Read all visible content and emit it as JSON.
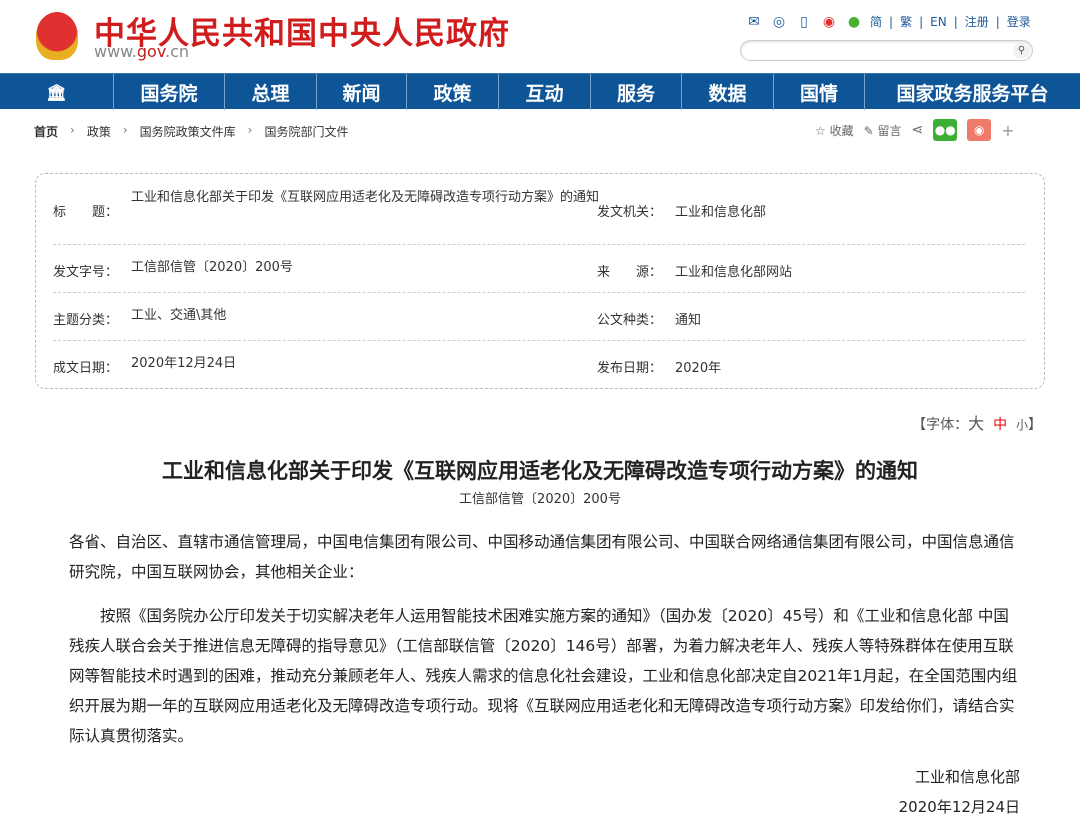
{
  "header": {
    "site_title": "中华人民共和国中央人民政府",
    "url_prefix": "www.",
    "url_mid": "gov",
    "url_suffix": ".cn",
    "links": [
      "简",
      "繁",
      "EN",
      "注册",
      "登录"
    ],
    "search_placeholder": ""
  },
  "nav": [
    "国务院",
    "总理",
    "新闻",
    "政策",
    "互动",
    "服务",
    "数据",
    "国情",
    "国家政务服务平台"
  ],
  "breadcrumb": [
    "首页",
    "政策",
    "国务院政策文件库",
    "国务院部门文件"
  ],
  "share": {
    "favorite": "收藏",
    "comment": "留言"
  },
  "info": {
    "title_label": "标　　题：",
    "title": "工业和信息化部关于印发《互联网应用适老化及无障碍改造专项行动方案》的通知",
    "issuer_label": "发文机关：",
    "issuer": "工业和信息化部",
    "docno_label": "发文字号：",
    "docno": "工信部信管〔2020〕200号",
    "source_label": "来　　源：",
    "source": "工业和信息化部网站",
    "topic_label": "主题分类：",
    "topic": "工业、交通\\其他",
    "type_label": "公文种类：",
    "type": "通知",
    "written_label": "成文日期：",
    "written": "2020年12月24日",
    "published_label": "发布日期：",
    "published": "2020年"
  },
  "fontsize": {
    "prefix": "【字体：",
    "large": "大",
    "medium": "中",
    "small": "小",
    "suffix": "】"
  },
  "article": {
    "title": "工业和信息化部关于印发《互联网应用适老化及无障碍改造专项行动方案》的通知",
    "doc_number": "工信部信管〔2020〕200号",
    "recipients": "各省、自治区、直辖市通信管理局，中国电信集团有限公司、中国移动通信集团有限公司、中国联合网络通信集团有限公司，中国信息通信研究院，中国互联网协会，其他相关企业：",
    "paragraph": "按照《国务院办公厅印发关于切实解决老年人运用智能技术困难实施方案的通知》（国办发〔2020〕45号）和《工业和信息化部 中国残疾人联合会关于推进信息无障碍的指导意见》（工信部联信管〔2020〕146号）部署，为着力解决老年人、残疾人等特殊群体在使用互联网等智能技术时遇到的困难，推动充分兼顾老年人、残疾人需求的信息化社会建设，工业和信息化部决定自2021年1月起，在全国范围内组织开展为期一年的互联网应用适老化及无障碍改造专项行动。现将《互联网应用适老化和无障碍改造专项行动方案》印发给你们，请结合实际认真贯彻落实。",
    "signature": "工业和信息化部",
    "date": "2020年12月24日"
  }
}
